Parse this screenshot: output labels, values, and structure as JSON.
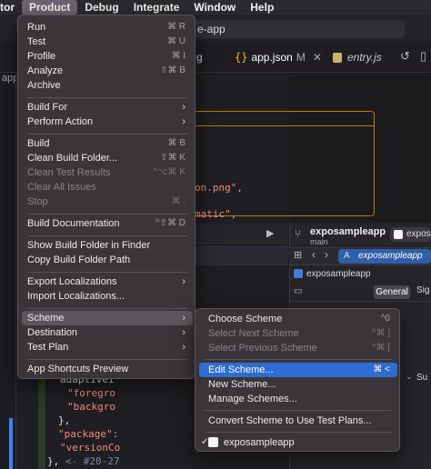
{
  "menubar": {
    "items": [
      "tor",
      "Product",
      "Debug",
      "Integrate",
      "Window",
      "Help"
    ],
    "active_index": 1
  },
  "toolbar": {
    "scheme_fragment": "e-app"
  },
  "tabs": {
    "partial_left": "g",
    "active_label": "app.json",
    "active_modified": "M",
    "active_close": "✕",
    "second_label": "entry.js"
  },
  "sidebar_fragment": "app",
  "editor": {
    "lines": {
      "l1": "on.png\",",
      "l2": "matic\",",
      "l3": "adaptivei",
      "l4": "\"foregro",
      "l5": "\"backgro",
      "l6": "},",
      "l7": "\"package\":",
      "l8": "\"versionCo",
      "l9": "}, ",
      "l9_hint": "<- #20-27"
    }
  },
  "inspector": {
    "project_title": "exposampleapp",
    "branch": "main",
    "chip_label": "exposa",
    "target_label": "exposampleapp",
    "project_label": "exposampleapp",
    "general_tab": "General",
    "sig_tab": "Sig",
    "su_fragment": "Su"
  },
  "product_menu": {
    "run": {
      "label": "Run",
      "shortcut": "⌘ R"
    },
    "test": {
      "label": "Test",
      "shortcut": "⌘ U"
    },
    "profile": {
      "label": "Profile",
      "shortcut": "⌘ I"
    },
    "analyze": {
      "label": "Analyze",
      "shortcut": "⇧⌘ B"
    },
    "archive": {
      "label": "Archive"
    },
    "build_for": {
      "label": "Build For"
    },
    "perform_action": {
      "label": "Perform Action"
    },
    "build": {
      "label": "Build",
      "shortcut": "⌘ B"
    },
    "clean_build_folder": {
      "label": "Clean Build Folder...",
      "shortcut": "⇧⌘ K"
    },
    "clean_test_results": {
      "label": "Clean Test Results",
      "shortcut": "^⌥⌘ K"
    },
    "clear_all_issues": {
      "label": "Clear All Issues"
    },
    "stop": {
      "label": "Stop",
      "shortcut": "⌘ ."
    },
    "build_documentation": {
      "label": "Build Documentation",
      "shortcut": "^⇧⌘ D"
    },
    "show_build_folder": {
      "label": "Show Build Folder in Finder"
    },
    "copy_build_folder_path": {
      "label": "Copy Build Folder Path"
    },
    "export_localizations": {
      "label": "Export Localizations"
    },
    "import_localizations": {
      "label": "Import Localizations..."
    },
    "scheme": {
      "label": "Scheme"
    },
    "destination": {
      "label": "Destination"
    },
    "test_plan": {
      "label": "Test Plan"
    },
    "app_shortcuts_preview": {
      "label": "App Shortcuts Preview"
    }
  },
  "scheme_submenu": {
    "choose_scheme": {
      "label": "Choose Scheme",
      "shortcut": "^0"
    },
    "select_next_scheme": {
      "label": "Select Next Scheme",
      "shortcut": "^⌘ ]"
    },
    "select_previous_scheme": {
      "label": "Select Previous Scheme",
      "shortcut": "^⌘ ["
    },
    "edit_scheme": {
      "label": "Edit Scheme...",
      "shortcut": "⌘ <"
    },
    "new_scheme": {
      "label": "New Scheme..."
    },
    "manage_schemes": {
      "label": "Manage Schemes..."
    },
    "convert_scheme": {
      "label": "Convert Scheme to Use Test Plans..."
    },
    "current_scheme": {
      "label": "exposampleapp",
      "checked": "✓"
    }
  },
  "colors": {
    "menu_bg": "#3a3539",
    "highlight_blue": "#2f6bd0",
    "hover_gray": "#5b565b",
    "accent_orange": "#b8791b"
  }
}
